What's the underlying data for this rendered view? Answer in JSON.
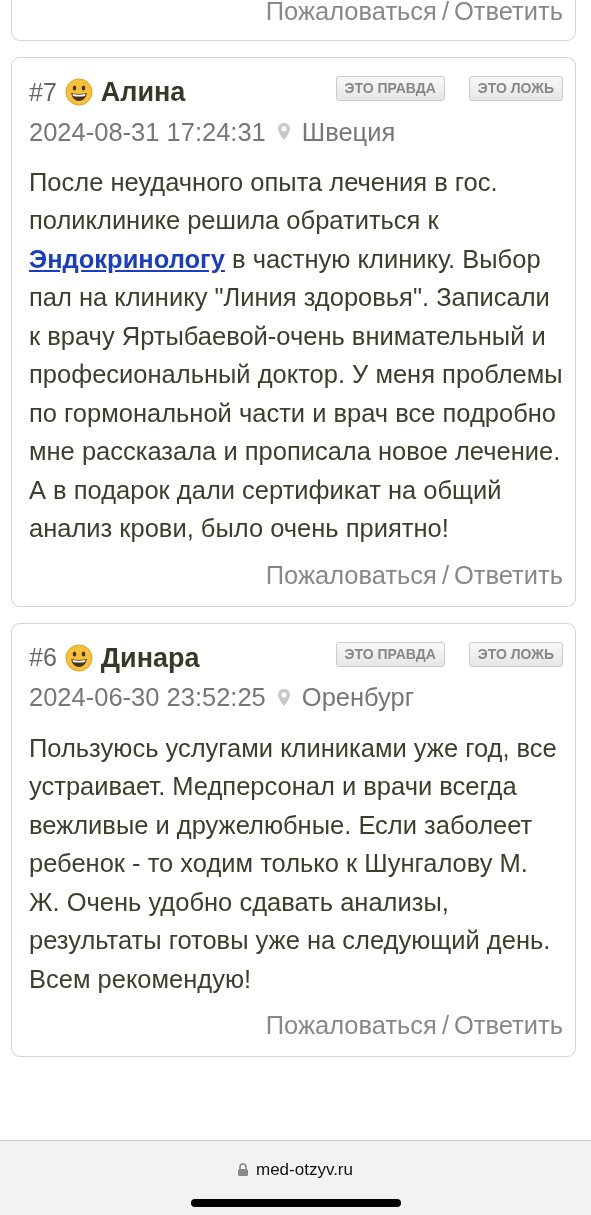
{
  "reviews": [
    {
      "actions": {
        "complain": "Пожаловаться",
        "separator": "/",
        "reply": "Ответить"
      }
    },
    {
      "number": "#7",
      "author": "Алина",
      "buttons": [
        "ЭТО ПРАВДА",
        "ЭТО ЛОЖЬ"
      ],
      "date": "2024-08-31 17:24:31",
      "location": "Швеция",
      "text_before": "После неудачного опыта лечения в гос. поликлинике решила обратиться к ",
      "link": "Эндокринологу",
      "text_after": " в частную клинику. Выбор пал на клинику \"Линия здоровья\". Записали к врачу Яртыбаевой-очень внимательный и професиональный доктор. У меня проблемы по гормональной части и врач все подробно мне рассказала и прописала новое лечение. А в подарок дали сертификат на общий анализ крови, было очень приятно!",
      "actions": {
        "complain": "Пожаловаться",
        "separator": "/",
        "reply": "Ответить"
      }
    },
    {
      "number": "#6",
      "author": "Динара",
      "buttons": [
        "ЭТО ПРАВДА",
        "ЭТО ЛОЖЬ"
      ],
      "date": "2024-06-30 23:52:25",
      "location": "Оренбург",
      "text_before": "Пользуюсь услугами клиниками уже год, все устраивает. Медперсонал и врачи всегда вежливые и дружелюбные. Если заболеет ребенок - то ходим только к Шунгалову М. Ж. Очень удобно сдавать анализы, результаты готовы уже на следующий день. Всем рекомендую!",
      "actions": {
        "complain": "Пожаловаться",
        "separator": "/",
        "reply": "Ответить"
      }
    }
  ],
  "browser": {
    "url": "med-otzyv.ru"
  }
}
